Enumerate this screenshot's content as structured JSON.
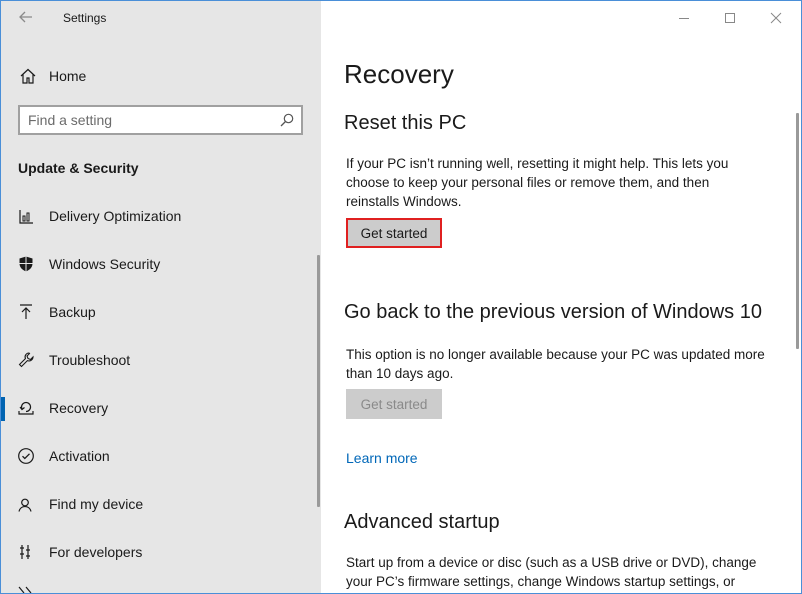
{
  "window": {
    "title": "Settings"
  },
  "sidebar": {
    "home_label": "Home",
    "search_placeholder": "Find a setting",
    "section_title": "Update & Security",
    "items": [
      {
        "label": "Delivery Optimization",
        "icon": "delivery-optimization-icon"
      },
      {
        "label": "Windows Security",
        "icon": "shield-icon"
      },
      {
        "label": "Backup",
        "icon": "backup-arrow-icon"
      },
      {
        "label": "Troubleshoot",
        "icon": "wrench-icon"
      },
      {
        "label": "Recovery",
        "icon": "recovery-icon",
        "selected": true
      },
      {
        "label": "Activation",
        "icon": "activation-check-icon"
      },
      {
        "label": "Find my device",
        "icon": "find-device-icon"
      },
      {
        "label": "For developers",
        "icon": "developer-tools-icon"
      }
    ]
  },
  "main": {
    "title": "Recovery",
    "reset": {
      "heading": "Reset this PC",
      "description_lines": [
        "If your PC isn’t running well, resetting it might help. This lets you",
        "choose to keep your personal files or remove them, and then",
        "reinstalls Windows."
      ],
      "button": "Get started"
    },
    "go_back": {
      "heading": "Go back to the previous version of Windows 10",
      "description_lines": [
        "This option is no longer available because your PC was updated more",
        "than 10 days ago."
      ],
      "button": "Get started",
      "link": "Learn more"
    },
    "advanced": {
      "heading": "Advanced startup",
      "description_lines": [
        "Start up from a device or disc (such as a USB drive or DVD), change",
        "your PC’s firmware settings, change Windows startup settings, or"
      ]
    }
  },
  "colors": {
    "accent": "#0063b1",
    "link": "#0067b8",
    "highlight_border": "#e02020",
    "sidebar_bg": "#e6e6e6"
  }
}
